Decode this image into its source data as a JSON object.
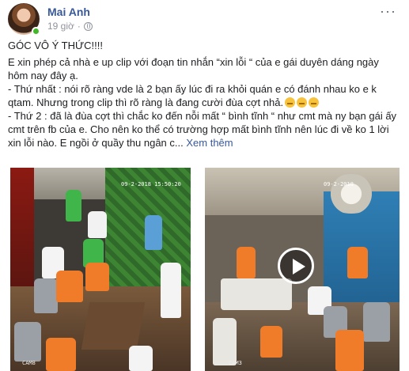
{
  "post": {
    "author": "Mai Anh",
    "time": "19 giờ",
    "more_label": "···",
    "title": "GÓC VÔ Ý THỨC!!!!",
    "paragraphs": [
      "E xin phép cả nhà e up clip với đoạn tin nhắn “xin lỗi “ của e gái duyên dáng ngày hôm nay đây ạ.",
      "- Thứ nhất : nói rõ ràng vde là 2 bạn ấy lúc đi ra khỏi quán e có đánh nhau ko e k qtam. Nhưng trong clip thì rõ ràng là đang cười đùa cợt nhả.",
      "- Thứ 2 : đã là đùa cợt thì chắc ko đến nỗi mất “ bình tĩnh “ như cmt mà ny bạn gái ấy cmt trên fb của e. Cho nên ko thể có trường hợp mất bình tĩnh nên lúc đi về ko 1 lời xin lỗi nào. E ngồi ở quầy thu ngân c..."
    ],
    "see_more": "Xem thêm",
    "icons": {
      "privacy": "globe-icon",
      "menu": "more-icon",
      "play": "play-icon"
    },
    "colors": {
      "author": "#385898",
      "meta": "#90949c",
      "link": "#385898"
    }
  },
  "media": {
    "left_clip": {
      "timestamp": "09-2-2018 15:50:20",
      "label": "CAM8"
    },
    "right_clip": {
      "timestamp": "09-2-2018",
      "label": "CAM3"
    }
  }
}
